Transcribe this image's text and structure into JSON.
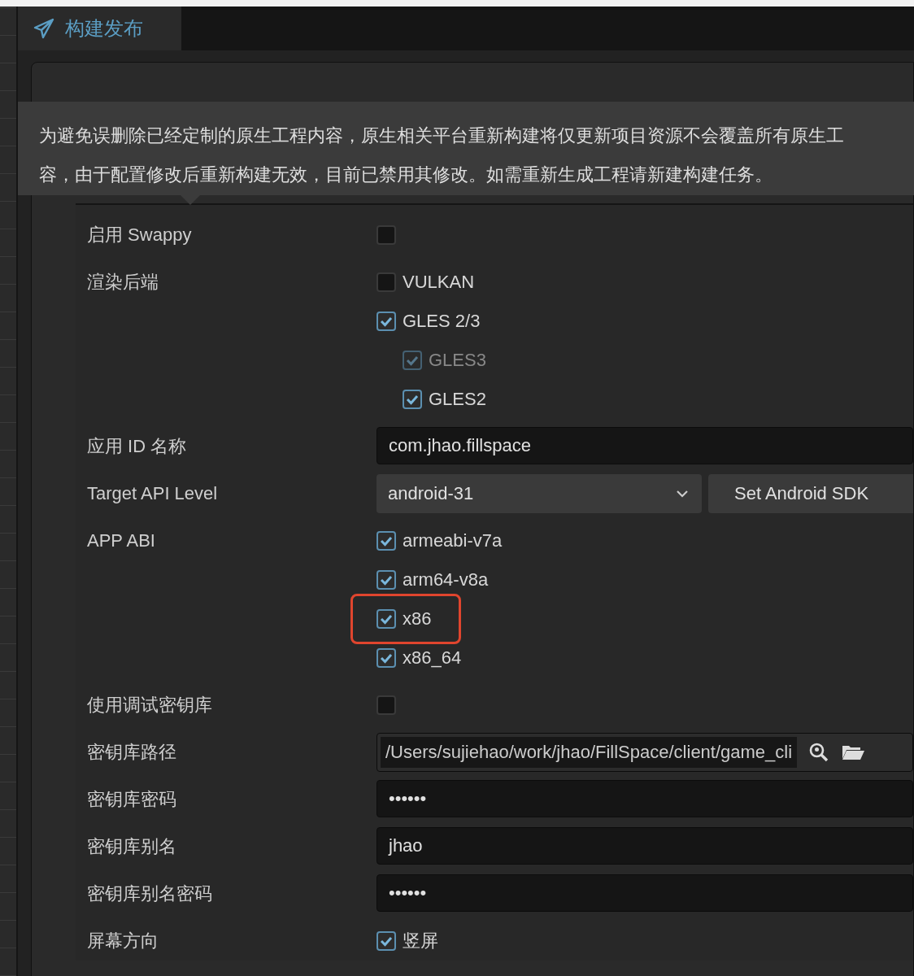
{
  "tab": {
    "label": "构建发布",
    "selected": true
  },
  "tooltip": {
    "lines": [
      "为避免误删除已经定制的原生工程内容，原生相关平台重新构建将仅更新项目资源不会覆盖所有原生工",
      "容，由于配置修改后重新构建无效，目前已禁用其修改。如需重新生成工程请新建构建任务。"
    ]
  },
  "rows": [
    {
      "kind": "checkbox",
      "label": "启用 Swappy",
      "checked": false
    },
    {
      "kind": "options",
      "label": "渲染后端",
      "options": [
        {
          "label": "VULKAN",
          "checked": false,
          "disabled": false,
          "highlighted": false
        },
        {
          "label": "GLES 2/3",
          "checked": true,
          "disabled": false,
          "highlighted": false,
          "children": [
            {
              "label": "GLES3",
              "checked": true,
              "disabled": true,
              "highlighted": false
            },
            {
              "label": "GLES2",
              "checked": true,
              "disabled": false,
              "highlighted": false
            }
          ]
        }
      ]
    },
    {
      "kind": "input",
      "label": "应用 ID 名称",
      "value": "com.jhao.fillspace"
    },
    {
      "kind": "select",
      "label": "Target API Level",
      "value": "android-31",
      "button": "Set Android SDK"
    },
    {
      "kind": "options",
      "label": "APP ABI",
      "options": [
        {
          "label": "armeabi-v7a",
          "checked": true,
          "disabled": false,
          "highlighted": false
        },
        {
          "label": "arm64-v8a",
          "checked": true,
          "disabled": false,
          "highlighted": false
        },
        {
          "label": "x86",
          "checked": true,
          "disabled": false,
          "highlighted": true
        },
        {
          "label": "x86_64",
          "checked": true,
          "disabled": false,
          "highlighted": false
        }
      ]
    },
    {
      "kind": "checkbox",
      "label": "使用调试密钥库",
      "checked": false
    },
    {
      "kind": "path",
      "label": "密钥库路径",
      "value": "/Users/sujiehao/work/jhao/FillSpace/client/game_cli"
    },
    {
      "kind": "input",
      "label": "密钥库密码",
      "value": "••••••"
    },
    {
      "kind": "input",
      "label": "密钥库别名",
      "value": "jhao"
    },
    {
      "kind": "input",
      "label": "密钥库别名密码",
      "value": "••••••"
    },
    {
      "kind": "options",
      "label": "屏幕方向",
      "options": [
        {
          "label": "竖屏",
          "checked": true,
          "disabled": false,
          "highlighted": false
        }
      ]
    }
  ]
}
